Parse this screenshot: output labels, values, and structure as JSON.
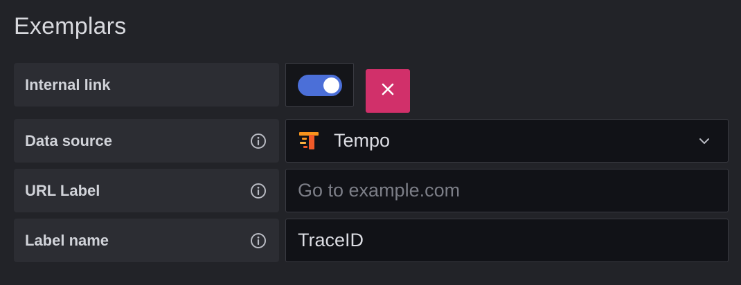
{
  "section": {
    "title": "Exemplars"
  },
  "internal_link": {
    "label": "Internal link",
    "enabled": true,
    "remove_label": "×"
  },
  "data_source": {
    "label": "Data source",
    "value": "Tempo",
    "icon": "tempo-logo"
  },
  "url_label": {
    "label": "URL Label",
    "value": "",
    "placeholder": "Go to example.com"
  },
  "label_name": {
    "label": "Label name",
    "value": "TraceID"
  },
  "colors": {
    "toggle_on": "#4b6fd8",
    "remove_button": "#d1306a"
  }
}
